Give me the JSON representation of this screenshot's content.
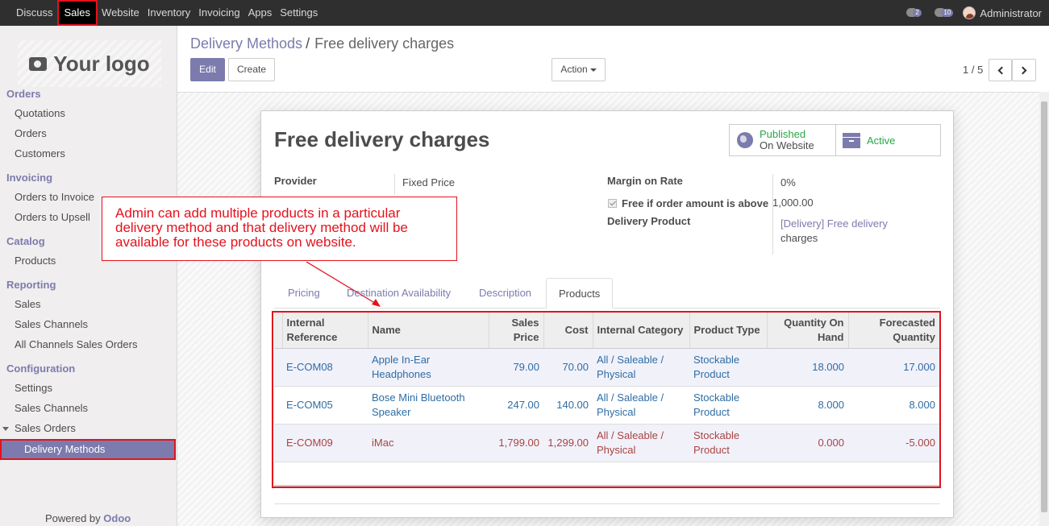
{
  "topnav": {
    "items": [
      {
        "label": "Discuss",
        "active": false
      },
      {
        "label": "Sales",
        "active": true
      },
      {
        "label": "Website",
        "active": false
      },
      {
        "label": "Inventory",
        "active": false
      },
      {
        "label": "Invoicing",
        "active": false
      },
      {
        "label": "Apps",
        "active": false
      },
      {
        "label": "Settings",
        "active": false
      }
    ],
    "messages_count": "2",
    "activity_count": "10",
    "user": "Administrator"
  },
  "sidebar": {
    "logo_text": "Your logo",
    "sections": [
      {
        "title": "Orders",
        "items": [
          "Quotations",
          "Orders",
          "Customers"
        ]
      },
      {
        "title": "Invoicing",
        "items": [
          "Orders to Invoice",
          "Orders to Upsell"
        ]
      },
      {
        "title": "Catalog",
        "items": [
          "Products"
        ]
      },
      {
        "title": "Reporting",
        "items": [
          "Sales",
          "Sales Channels",
          "All Channels Sales Orders"
        ]
      },
      {
        "title": "Configuration",
        "items": [
          "Settings",
          "Sales Channels",
          "Sales Orders"
        ]
      }
    ],
    "active_item": "Delivery Methods",
    "powered_prefix": "Powered by",
    "powered_brand": "Odoo"
  },
  "breadcrumb": {
    "parent": "Delivery Methods",
    "separator": "/",
    "current": "Free delivery charges"
  },
  "buttons": {
    "edit": "Edit",
    "create": "Create",
    "action": "Action"
  },
  "pager": {
    "value": "1 / 5"
  },
  "record": {
    "title": "Free delivery charges",
    "published_line1": "Published",
    "published_line2": "On Website",
    "active_label": "Active",
    "provider_label": "Provider",
    "provider_value": "Fixed Price",
    "margin_label": "Margin on Rate",
    "margin_value": "0%",
    "free_label": "Free if order amount is above",
    "free_checked": true,
    "free_value": "1,000.00",
    "delivery_product_label": "Delivery Product",
    "delivery_product_line1": "[Delivery] Free delivery",
    "delivery_product_line2": "charges"
  },
  "annotation": {
    "line1": "Admin can add multiple products in a particular",
    "line2": "delivery method and that delivery method will be",
    "line3": "available for these products on website."
  },
  "tabs": [
    {
      "label": "Pricing",
      "active": false
    },
    {
      "label": "Destination Availability",
      "active": false
    },
    {
      "label": "Description",
      "active": false
    },
    {
      "label": "Products",
      "active": true
    }
  ],
  "products_table": {
    "headers": {
      "ref1": "Internal",
      "ref2": "Reference",
      "name": "Name",
      "price1": "Sales",
      "price2": "Price",
      "cost": "Cost",
      "category": "Internal Category",
      "type": "Product Type",
      "qoh1": "Quantity On",
      "qoh2": "Hand",
      "fq1": "Forecasted",
      "fq2": "Quantity"
    },
    "rows": [
      {
        "ref": "E-COM08",
        "name1": "Apple In-Ear",
        "name2": "Headphones",
        "price": "79.00",
        "cost": "70.00",
        "cat1": "All / Saleable /",
        "cat2": "Physical",
        "type1": "Stockable",
        "type2": "Product",
        "qoh": "18.000",
        "fq": "17.000"
      },
      {
        "ref": "E-COM05",
        "name1": "Bose Mini Bluetooth",
        "name2": "Speaker",
        "price": "247.00",
        "cost": "140.00",
        "cat1": "All / Saleable /",
        "cat2": "Physical",
        "type1": "Stockable",
        "type2": "Product",
        "qoh": "8.000",
        "fq": "8.000"
      },
      {
        "ref": "E-COM09",
        "name1": "iMac",
        "name2": "",
        "price": "1,799.00",
        "cost": "1,299.00",
        "cat1": "All / Saleable /",
        "cat2": "Physical",
        "type1": "Stockable",
        "type2": "Product",
        "qoh": "0.000",
        "fq": "-5.000"
      }
    ]
  },
  "colors": {
    "brand": "#7c7bad",
    "annotation": "#e3121c",
    "link": "#2e6da4",
    "negative": "#a94442",
    "success": "#28a745"
  }
}
